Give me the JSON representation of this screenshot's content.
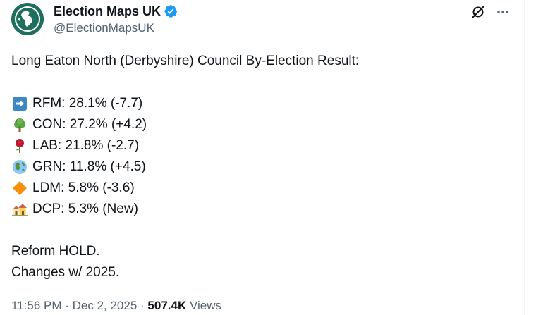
{
  "author": {
    "display_name": "Election Maps UK",
    "handle": "@ElectionMapsUK",
    "verified_icon": "verified-badge-icon",
    "avatar_icon": "globe-map-icon"
  },
  "actions": {
    "grok_icon": "grok-icon",
    "more_icon": "more-icon"
  },
  "tweet": {
    "headline": "Long Eaton North (Derbyshire) Council By-Election Result:",
    "results": [
      {
        "icon": "right-arrow-icon",
        "text": "RFM: 28.1% (-7.7)"
      },
      {
        "icon": "tree-icon",
        "text": "CON: 27.2% (+4.2)"
      },
      {
        "icon": "rose-icon",
        "text": "LAB: 21.8% (-2.7)"
      },
      {
        "icon": "globe-icon",
        "text": "GRN: 11.8% (+4.5)"
      },
      {
        "icon": "orange-diamond-icon",
        "text": "LDM: 5.8% (-3.6)"
      },
      {
        "icon": "houses-icon",
        "text": "DCP: 5.3% (New)"
      }
    ],
    "outcome": "Reform HOLD.",
    "note": "Changes w/ 2025."
  },
  "meta": {
    "time": "11:56 PM",
    "separator_1": " · ",
    "date": "Dec 2, 2025",
    "separator_2": " · ",
    "views_count": "507.4K",
    "views_label": " Views"
  },
  "colors": {
    "text": "#0f1419",
    "secondary": "#536471",
    "verified": "#1d9bf0",
    "avatar_bg": "#1f6f5f"
  }
}
